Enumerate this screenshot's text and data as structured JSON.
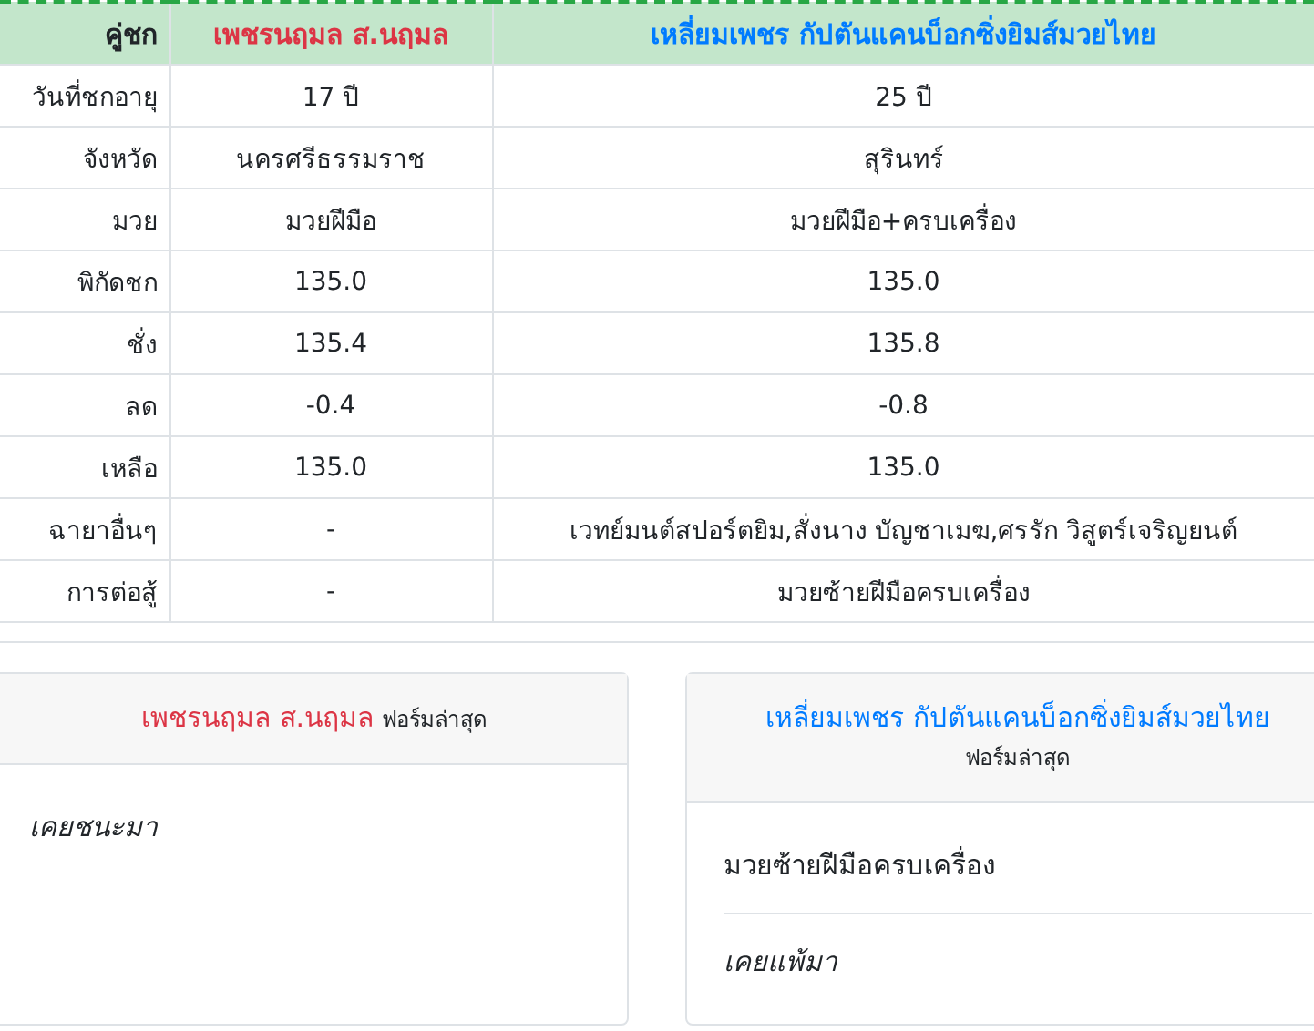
{
  "table": {
    "header_label": "คู่ชก",
    "fighters": [
      {
        "name": "เพชรนฤมล ส.นฤมล",
        "color": "#dc3545"
      },
      {
        "name": "เหลี่ยมเพชร กัปตันแคนบ็อกซิ่งยิมส์มวยไทย",
        "color": "#007bff"
      }
    ],
    "rows": [
      {
        "label": "วันที่ชกอายุ",
        "values": [
          "17 ปี",
          "25 ปี"
        ]
      },
      {
        "label": "จังหวัด",
        "values": [
          "นครศรีธรรมราช",
          "สุรินทร์"
        ]
      },
      {
        "label": "มวย",
        "values": [
          "มวยฝีมือ",
          "มวยฝีมือ+ครบเครื่อง"
        ]
      },
      {
        "label": "พิกัดชก",
        "values": [
          "135.0",
          "135.0"
        ]
      },
      {
        "label": "ชั่ง",
        "values": [
          "135.4",
          "135.8"
        ]
      },
      {
        "label": "ลด",
        "values": [
          "-0.4",
          "-0.8"
        ]
      },
      {
        "label": "เหลือ",
        "values": [
          "135.0",
          "135.0"
        ]
      },
      {
        "label": "ฉายาอื่นๆ",
        "values": [
          "-",
          "เวทย์มนต์สปอร์ตยิม,สั่งนาง บัญชาเมฆ,ศรรัก วิสูตร์เจริญยนต์"
        ]
      },
      {
        "label": "การต่อสู้",
        "values": [
          "-",
          "มวยซ้ายฝีมือครบเครื่อง"
        ]
      }
    ]
  },
  "cards": [
    {
      "name": "เพชรนฤมล ส.นฤมล",
      "color": "#dc3545",
      "subtitle": "ฟอร์มล่าสุด",
      "items": [
        {
          "kind": "result",
          "text": "เคยชนะมา"
        }
      ]
    },
    {
      "name": "เหลี่ยมเพชร กัปตันแคนบ็อกซิ่งยิมส์มวยไทย",
      "color": "#007bff",
      "subtitle": "ฟอร์มล่าสุด",
      "items": [
        {
          "kind": "style",
          "text": "มวยซ้ายฝีมือครบเครื่อง"
        },
        {
          "kind": "result",
          "text": "เคยแพ้มา"
        }
      ]
    }
  ]
}
